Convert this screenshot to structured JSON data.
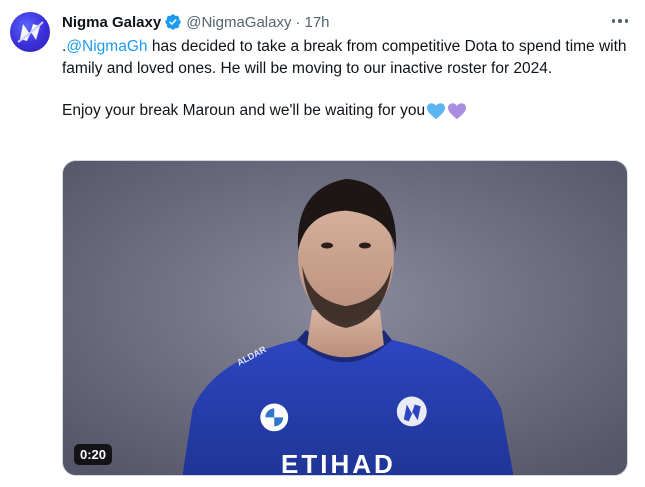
{
  "tweet": {
    "author_name": "Nigma Galaxy",
    "author_handle": "@NigmaGalaxy",
    "separator": "·",
    "time": "17h",
    "text_prefix": ".",
    "mention": "@NigmaGh",
    "text_line1_rest": " has decided to take a break from competitive Dota to spend time with family and loved ones. He will be moving to our inactive roster for 2024.",
    "text_para2": "Enjoy your break Maroun and we'll be waiting for you",
    "emoji": [
      "blue-heart",
      "purple-heart"
    ]
  },
  "media": {
    "type": "video",
    "duration": "0:20",
    "jersey_sponsor": "ETIHAD",
    "jersey_small_sponsor": "ALDAR"
  },
  "colors": {
    "accent": "#1d9bf0",
    "text": "#0f1419",
    "muted": "#536471",
    "jersey": "#2a3fb0",
    "heart_blue": "#5db4f5",
    "heart_purple": "#a98de0"
  }
}
